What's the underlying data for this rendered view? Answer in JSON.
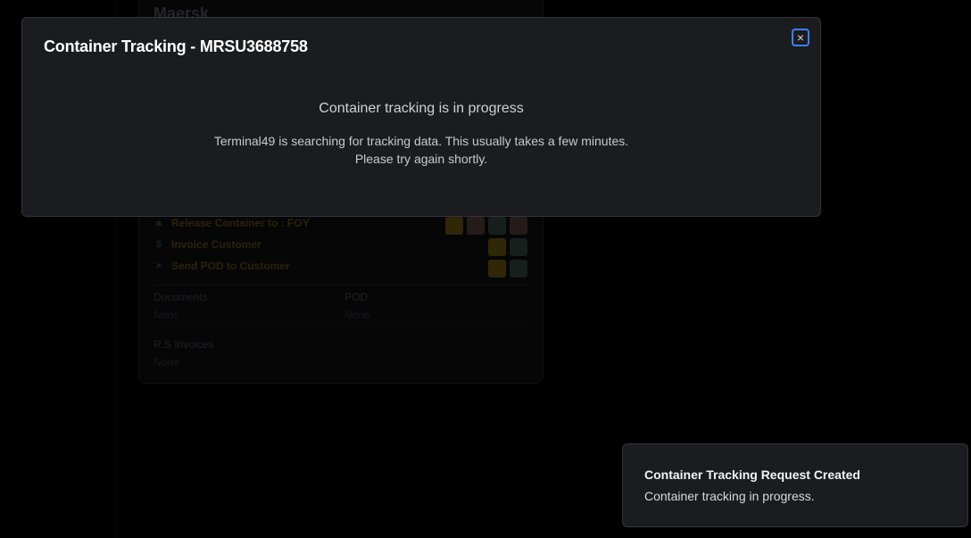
{
  "background": {
    "card_title": "Maersk",
    "tasks": [
      {
        "label": "Release Container to : FOY",
        "icon": "lock-icon"
      },
      {
        "label": "Invoice Customer",
        "icon": "dollar-icon"
      },
      {
        "label": "Send POD to Customer",
        "icon": "send-icon"
      }
    ],
    "documents_label": "Documents",
    "documents_value": "None",
    "pod_label": "POD",
    "pod_value": "None",
    "rs_invoices_label": "R.S Invoices",
    "rs_invoices_value": "None",
    "status_colors": {
      "yellow": "#4a3c0b",
      "red": "#3a2b28",
      "green": "#22312a"
    }
  },
  "modal": {
    "title": "Container Tracking - MRSU3688758",
    "close_icon": "×",
    "heading": "Container tracking is in progress",
    "line1": "Terminal49 is searching for tracking data. This usually takes a few minutes.",
    "line2": "Please try again shortly."
  },
  "toast": {
    "title": "Container Tracking Request Created",
    "message": "Container tracking in progress."
  },
  "colors": {
    "accent": "#3b82f6",
    "modal_bg": "#1b1c20",
    "page_bg": "#000000"
  }
}
